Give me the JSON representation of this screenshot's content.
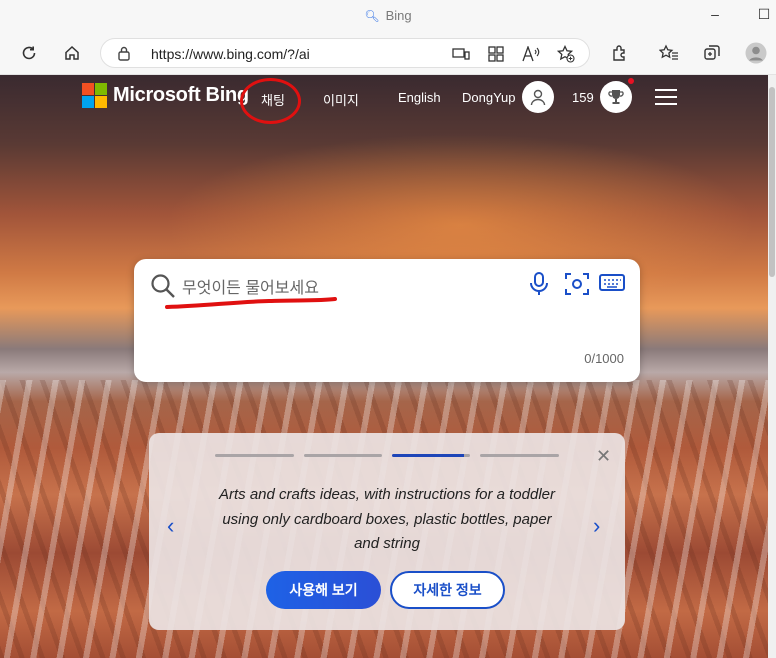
{
  "window": {
    "title": "Bing"
  },
  "toolbar": {
    "url": "https://www.bing.com/?/ai"
  },
  "header": {
    "brand": "Microsoft Bing",
    "nav": [
      "채팅",
      "이미지",
      "English"
    ],
    "user_name": "DongYup",
    "points": "159"
  },
  "search": {
    "placeholder": "무엇이든 물어보세요",
    "char_count": "0/1000"
  },
  "suggestion": {
    "text": "Arts and crafts ideas, with instructions for a toddler using only cardboard boxes, plastic bottles, paper and string",
    "try_label": "사용해 보기",
    "more_label": "자세한 정보",
    "active_index": 3,
    "total": 4
  },
  "colors": {
    "accent": "#1a4fc8",
    "annotation_red": "#e01010",
    "notification": "#e81123"
  },
  "icons": [
    "search-icon",
    "refresh-icon",
    "home-icon",
    "lock-icon",
    "immersive-reader-icon",
    "apps-icon",
    "read-aloud-icon",
    "favorite-add-icon",
    "extensions-icon",
    "favorites-icon",
    "collections-icon",
    "profile-icon",
    "mic-icon",
    "visual-search-icon",
    "keyboard-icon",
    "close-icon",
    "chevron-left-icon",
    "chevron-right-icon",
    "rewards-trophy-icon",
    "menu-icon"
  ]
}
